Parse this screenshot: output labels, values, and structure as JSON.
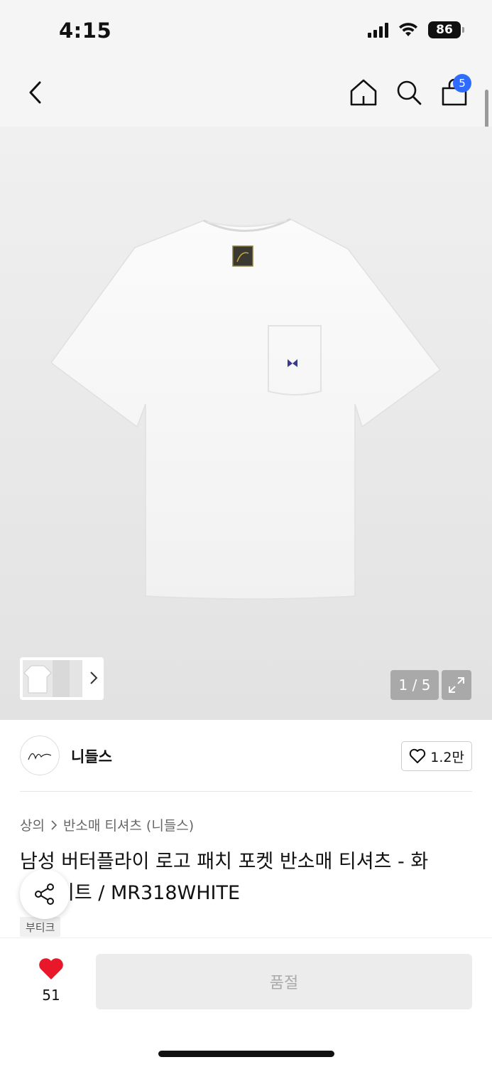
{
  "status_bar": {
    "time": "4:15",
    "battery": "86"
  },
  "nav": {
    "cart_count": "5"
  },
  "gallery": {
    "page_counter": "1 / 5",
    "current_page": 1,
    "total_pages": 5,
    "brand_tag_text": "Needles"
  },
  "brand": {
    "name": "니들스",
    "logo_text": "Needles",
    "likes": "1.2만"
  },
  "breadcrumb": {
    "category": "상의",
    "subcategory": "반소매 티셔츠 (니들스)"
  },
  "product": {
    "title_line1": "남성 버터플라이 로고 패치 포켓 반소매 티셔츠 - 화",
    "title_line2": "이트 / MR318WHITE",
    "badge": "부티크"
  },
  "bottom_bar": {
    "wish_count": "51",
    "action_label": "품절"
  },
  "colors": {
    "accent": "#2f6bff",
    "heart": "#e8182a",
    "butterfly": "#3a3a8c"
  },
  "icons": [
    "back-icon",
    "home-icon",
    "search-icon",
    "bag-icon",
    "chevron-right-icon",
    "expand-icon",
    "heart-outline-icon",
    "share-icon",
    "heart-filled-icon"
  ]
}
